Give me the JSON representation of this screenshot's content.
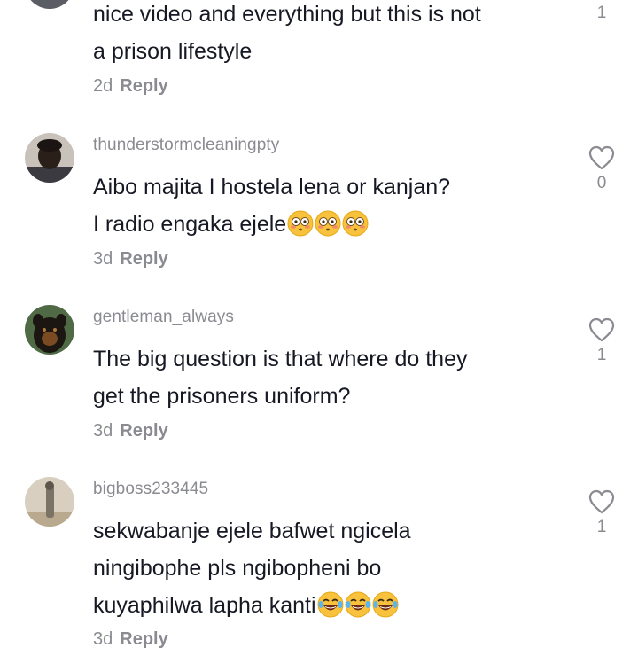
{
  "comments": [
    {
      "username": "",
      "lines": [
        "nice video and everything but this is not",
        "a prison lifestyle"
      ],
      "time": "2d",
      "reply_label": "Reply",
      "likes": "1"
    },
    {
      "username": "thunderstormcleaningpty",
      "lines": [
        "Aibo majita I hostela lena or kanjan?",
        "I radio engaka ejele"
      ],
      "emoji": "flushed-face",
      "emoji_count": 3,
      "time": "3d",
      "reply_label": "Reply",
      "likes": "0"
    },
    {
      "username": "gentleman_always",
      "lines": [
        "The big question is that where do they",
        "get the prisoners uniform?"
      ],
      "time": "3d",
      "reply_label": "Reply",
      "likes": "1"
    },
    {
      "username": "bigboss233445",
      "lines": [
        "sekwabanje ejele bafwet ngicela",
        "ningibophe pls ngibopheni bo",
        "kuyaphilwa lapha kanti"
      ],
      "emoji": "tears-of-joy-face",
      "emoji_count": 3,
      "time": "3d",
      "reply_label": "Reply",
      "likes": "1"
    }
  ],
  "icons": {
    "like": "heart-outline-icon"
  },
  "colors": {
    "text": "#161823",
    "secondary": "#8a8b91",
    "background": "#ffffff"
  }
}
